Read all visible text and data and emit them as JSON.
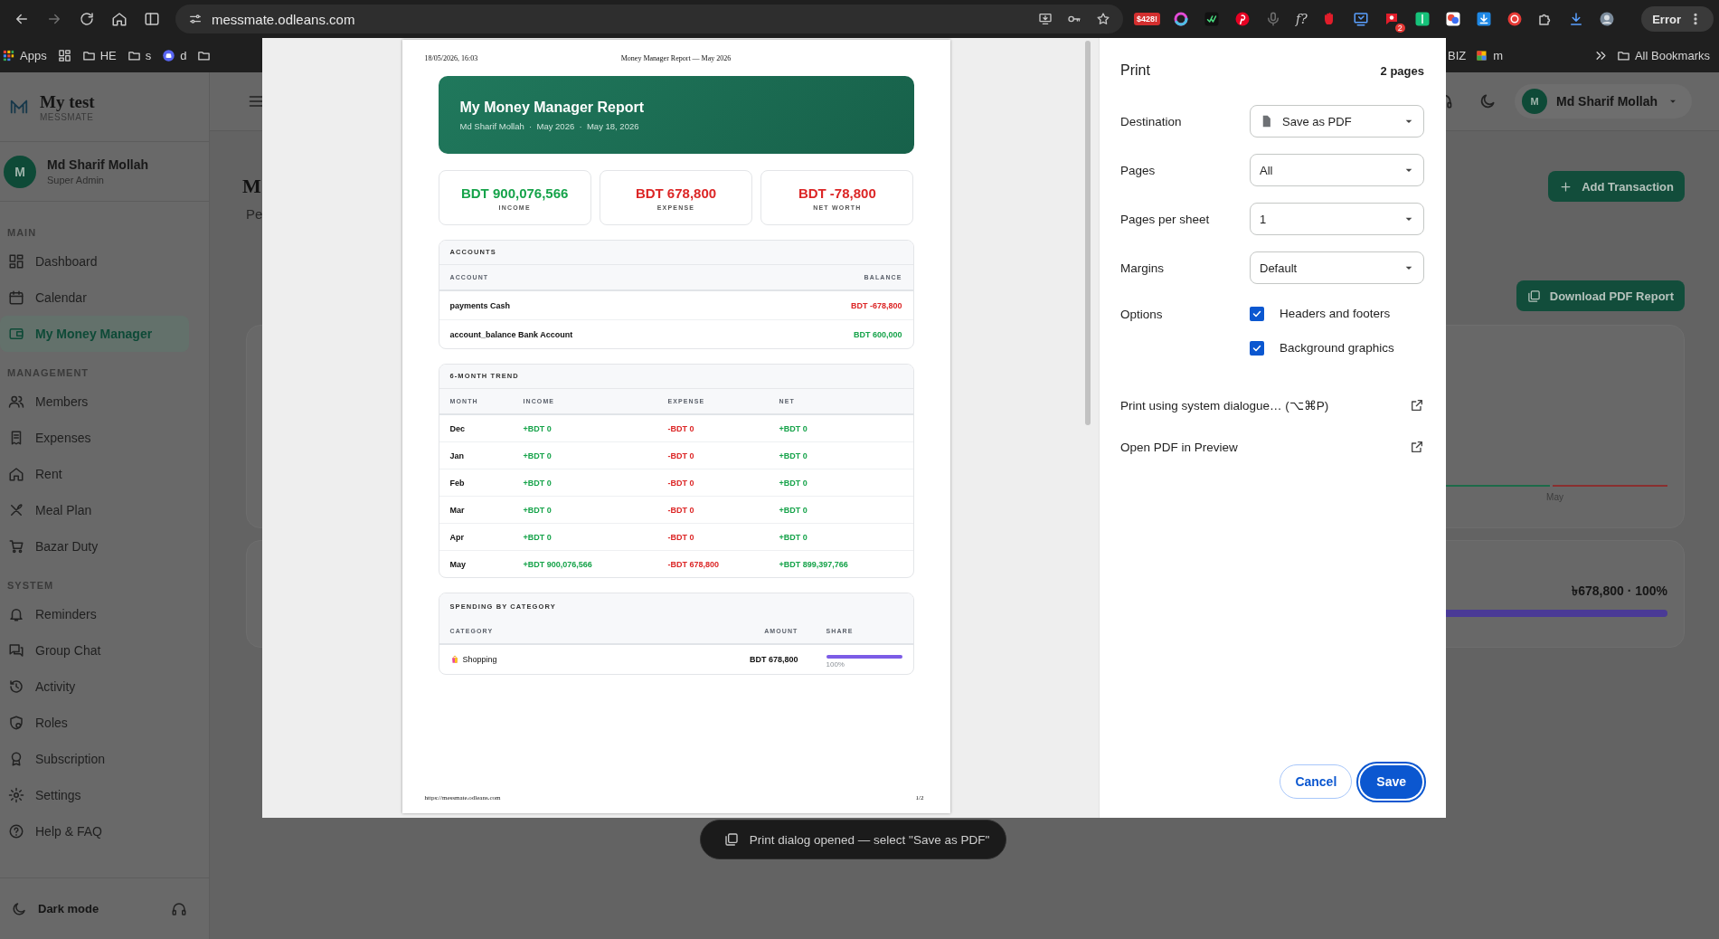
{
  "browser": {
    "url": "messmate.odleans.com",
    "extension_badge": "$428!",
    "extension_glyph": "f?",
    "notification_count": "2",
    "profile_button": "Error"
  },
  "bookmarks": [
    {
      "kind": "apps",
      "label": "Apps"
    },
    {
      "kind": "grid"
    },
    {
      "kind": "folder",
      "label": "HE"
    },
    {
      "kind": "folder",
      "label": "s"
    },
    {
      "kind": "discord",
      "label": "d"
    },
    {
      "kind": "folder"
    }
  ],
  "bookmarks_right": [
    {
      "kind": "text",
      "label": "BIZ"
    },
    {
      "kind": "google",
      "label": "m"
    }
  ],
  "all_bookmarks": "All Bookmarks",
  "sidebar": {
    "brand": "My test",
    "brand_sub": "MESSMATE",
    "user": {
      "initial": "M",
      "name": "Md Sharif Mollah",
      "role": "Super Admin"
    },
    "sections": [
      {
        "title": "MAIN",
        "items": [
          {
            "label": "Dashboard",
            "selected": false
          },
          {
            "label": "Calendar",
            "selected": false
          },
          {
            "label": "My Money Manager",
            "selected": true
          }
        ]
      },
      {
        "title": "MANAGEMENT",
        "items": [
          {
            "label": "Members",
            "selected": false
          },
          {
            "label": "Expenses",
            "selected": false
          },
          {
            "label": "Rent",
            "selected": false
          },
          {
            "label": "Meal Plan",
            "selected": false
          },
          {
            "label": "Bazar Duty",
            "selected": false
          }
        ]
      },
      {
        "title": "SYSTEM",
        "items": [
          {
            "label": "Reminders",
            "selected": false
          },
          {
            "label": "Group Chat",
            "selected": false
          },
          {
            "label": "Activity",
            "selected": false
          },
          {
            "label": "Roles",
            "selected": false
          },
          {
            "label": "Subscription",
            "selected": false
          },
          {
            "label": "Settings",
            "selected": false
          },
          {
            "label": "Help & FAQ",
            "selected": false
          }
        ]
      }
    ],
    "dark_mode": "Dark mode"
  },
  "topbar": {
    "avatar_initial": "M",
    "user_name": "Md Sharif Mollah"
  },
  "page": {
    "title": "M",
    "subtitle": "Pe",
    "add_button": "Add Transaction",
    "download_button": "Download PDF Report",
    "trend_card": {
      "x_label": "May"
    },
    "category_card": {
      "summary": "৳678,800 · 100%",
      "level": 1
    }
  },
  "print_dialog": {
    "preview": {
      "header_left": "18/05/2026, 16:03",
      "header_center": "Money Manager Report — May 2026",
      "banner_title": "My Money Manager Report",
      "banner_subtitle": "Md Sharif Mollah  ·  May 2026  ·  May 18, 2026",
      "stats": [
        {
          "value": "BDT 900,076,566",
          "label": "INCOME",
          "color": "#16a34a"
        },
        {
          "value": "BDT 678,800",
          "label": "EXPENSE",
          "color": "#dc2626"
        },
        {
          "value": "BDT -78,800",
          "label": "NET WORTH",
          "color": "#dc2626"
        }
      ],
      "accounts": {
        "title": "ACCOUNTS",
        "columns": [
          "ACCOUNT",
          "BALANCE"
        ],
        "rows": [
          {
            "name": "payments Cash",
            "balance": "BDT -678,800",
            "color": "#dc2626"
          },
          {
            "name": "account_balance Bank Account",
            "balance": "BDT 600,000",
            "color": "#16a34a"
          }
        ]
      },
      "trend": {
        "title": "6-MONTH TREND",
        "columns": [
          "MONTH",
          "INCOME",
          "EXPENSE",
          "NET"
        ],
        "rows": [
          [
            "Dec",
            "+BDT 0",
            "-BDT 0",
            "+BDT 0"
          ],
          [
            "Jan",
            "+BDT 0",
            "-BDT 0",
            "+BDT 0"
          ],
          [
            "Feb",
            "+BDT 0",
            "-BDT 0",
            "+BDT 0"
          ],
          [
            "Mar",
            "+BDT 0",
            "-BDT 0",
            "+BDT 0"
          ],
          [
            "Apr",
            "+BDT 0",
            "-BDT 0",
            "+BDT 0"
          ],
          [
            "May",
            "+BDT 900,076,566",
            "-BDT 678,800",
            "+BDT 899,397,766"
          ]
        ]
      },
      "spending": {
        "title": "SPENDING BY CATEGORY",
        "columns": [
          "CATEGORY",
          "AMOUNT",
          "SHARE"
        ],
        "rows": [
          {
            "name": "Shopping",
            "amount": "BDT 678,800",
            "share": "100%",
            "level": 1
          }
        ]
      },
      "footer_left": "https://messmate.odleans.com",
      "footer_right": "1/2"
    },
    "settings": {
      "title": "Print",
      "page_count": "2 pages",
      "fields": [
        {
          "label": "Destination",
          "value": "Save as PDF",
          "kind": "destination"
        },
        {
          "label": "Pages",
          "value": "All",
          "kind": "select"
        },
        {
          "label": "Pages per sheet",
          "value": "1",
          "kind": "select"
        },
        {
          "label": "Margins",
          "value": "Default",
          "kind": "select"
        }
      ],
      "options_label": "Options",
      "options": [
        {
          "label": "Headers and footers",
          "checked": true
        },
        {
          "label": "Background graphics",
          "checked": true
        }
      ],
      "links": [
        "Print using system dialogue… (⌥⌘P)",
        "Open PDF in Preview"
      ],
      "cancel": "Cancel",
      "save": "Save"
    }
  },
  "toast": "Print dialog opened — select \"Save as PDF\""
}
